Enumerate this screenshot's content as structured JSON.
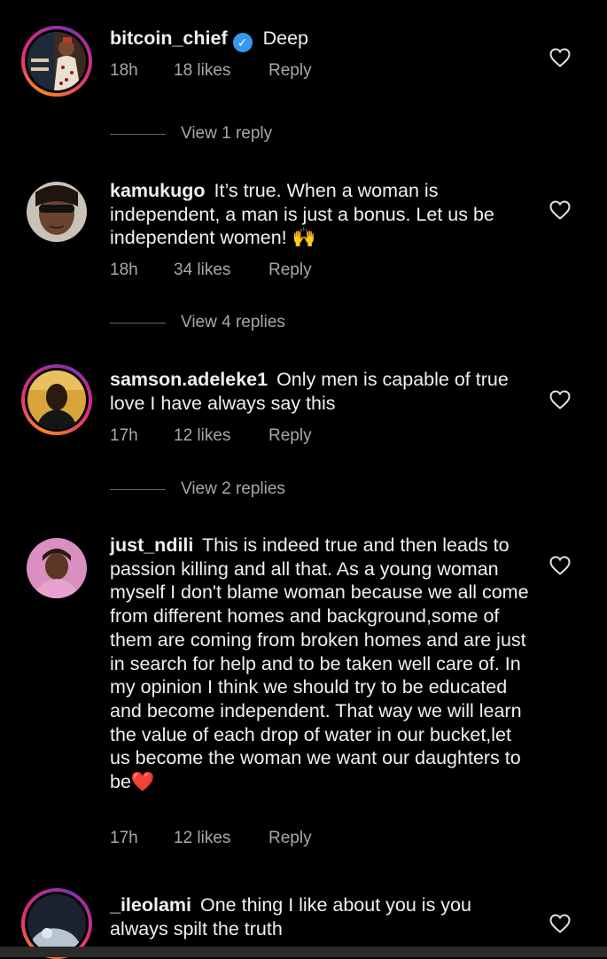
{
  "comments": [
    {
      "username": "bitcoin_chief",
      "verified": true,
      "text": "Deep",
      "time": "18h",
      "likes": "18 likes",
      "reply": "Reply",
      "view_replies": "View 1 reply"
    },
    {
      "username": "kamukugo",
      "verified": false,
      "text": "It’s true. When a woman is independent,  a man is just a bonus. Let us be independent women! 🙌",
      "time": "18h",
      "likes": "34 likes",
      "reply": "Reply",
      "view_replies": "View 4 replies"
    },
    {
      "username": "samson.adeleke1",
      "verified": false,
      "text": "Only men is capable of true love I have always say this",
      "time": "17h",
      "likes": "12 likes",
      "reply": "Reply",
      "view_replies": "View 2 replies"
    },
    {
      "username": "just_ndili",
      "verified": false,
      "text": "This is indeed true and then leads to passion killing and all that. As a young woman myself I don't blame woman because we all come from different homes and background,some of them are coming from broken homes and are just in search for help and to be taken well care of. In my opinion I think we should try to be educated and become independent. That way we will learn the value of each drop of water in our bucket,let us become the woman we want our daughters to be❤️",
      "time": "17h",
      "likes": "12 likes",
      "reply": "Reply"
    },
    {
      "username": "_ileolami",
      "verified": false,
      "text": "One thing I like about you is you always spilt the truth"
    }
  ],
  "icons": {
    "like": "heart-outline-icon",
    "verified": "verified-badge-icon"
  },
  "colors": {
    "background": "#000000",
    "meta_text": "#a8a8a8",
    "verified": "#3897f0",
    "story_ring": "#dd2a7b"
  }
}
